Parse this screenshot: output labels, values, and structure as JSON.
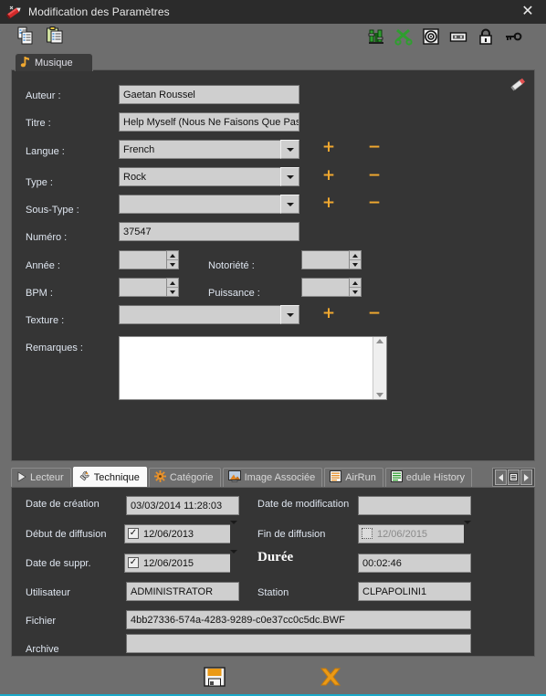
{
  "window": {
    "title": "Modification des Paramètres",
    "close_label": "✕",
    "title_icon": "marker-pen-icon",
    "accent_color": "#f0a830",
    "panel_bg": "#353535",
    "chrome_bg": "#6e6e6e",
    "titlebar_bg": "#2b2b2b",
    "bottom_accent": "#1ba9c9"
  },
  "toolbar": {
    "left_icons": [
      {
        "name": "copy-icon",
        "label": "Copier"
      },
      {
        "name": "paste-icon",
        "label": "Coller"
      }
    ],
    "right_icons": [
      {
        "name": "mixer-icon",
        "label": "Mixage"
      },
      {
        "name": "scissors-icon",
        "label": "Couper"
      },
      {
        "name": "target-icon",
        "label": "Cible"
      },
      {
        "name": "cassette-icon",
        "label": "Cassette"
      },
      {
        "name": "lock-icon",
        "label": "Verrouiller"
      },
      {
        "name": "key-icon",
        "label": "Clé"
      }
    ]
  },
  "main_tab": {
    "label": "Musique",
    "icon": "music-note-icon"
  },
  "pencil_icon": "pencil-icon",
  "form": {
    "fields": [
      {
        "id": "auteur",
        "label": "Auteur :",
        "value": "Gaetan Roussel",
        "type": "text"
      },
      {
        "id": "titre",
        "label": "Titre :",
        "value": "Help Myself (Nous Ne Faisons Que Pas",
        "type": "text"
      },
      {
        "id": "langue",
        "label": "Langue :",
        "value": "French",
        "type": "combo"
      },
      {
        "id": "type",
        "label": "Type :",
        "value": "Rock",
        "type": "combo"
      },
      {
        "id": "sous-type",
        "label": "Sous-Type :",
        "value": "",
        "type": "combo"
      },
      {
        "id": "numero",
        "label": "Numéro :",
        "value": "37547",
        "type": "text"
      }
    ],
    "spinners": [
      {
        "id": "annee",
        "label": "Année :",
        "value": ""
      },
      {
        "id": "notoriete",
        "label": "Notoriété :",
        "value": ""
      },
      {
        "id": "bpm",
        "label": "BPM :",
        "value": ""
      },
      {
        "id": "puissance",
        "label": "Puissance :",
        "value": ""
      }
    ],
    "texture": {
      "label": "Texture :",
      "value": ""
    },
    "remarques": {
      "label": "Remarques :",
      "value": ""
    },
    "add_label": "+",
    "remove_label": "−"
  },
  "tabs": [
    {
      "label": "Lecteur",
      "icon": "play-triangle-icon",
      "active": false
    },
    {
      "label": "Technique",
      "icon": "wrench-icon",
      "active": true
    },
    {
      "label": "Catégorie",
      "icon": "gear-orange-icon",
      "active": false
    },
    {
      "label": "Image Associée",
      "icon": "picture-icon",
      "active": false
    },
    {
      "label": "AirRun",
      "icon": "list-orange-icon",
      "active": false
    },
    {
      "label": "edule History",
      "icon": "list-green-icon",
      "active": false
    }
  ],
  "tab_nav": {
    "prev": "tab-scroll-left",
    "list": "tab-list",
    "next": "tab-scroll-right"
  },
  "technique": {
    "date_creation": {
      "label": "Date de création",
      "value": "03/03/2014 11:28:03"
    },
    "date_modification": {
      "label": "Date de modification",
      "value": ""
    },
    "debut_diffusion": {
      "label": "Début de diffusion",
      "value": "12/06/2013",
      "checked": true,
      "check_glyph": "✓"
    },
    "fin_diffusion": {
      "label": "Fin de diffusion",
      "value": "12/06/2015",
      "checked": false,
      "check_glyph": ""
    },
    "date_suppr": {
      "label": "Date de suppr.",
      "value": "12/06/2015",
      "checked": true,
      "check_glyph": "✓"
    },
    "duree": {
      "label": "Durée",
      "value": "00:02:46"
    },
    "utilisateur": {
      "label": "Utilisateur",
      "value": "ADMINISTRATOR"
    },
    "station": {
      "label": "Station",
      "value": "CLPAPOLINI1"
    },
    "fichier": {
      "label": "Fichier",
      "value": "4bb27336-574a-4283-9289-c0e37cc0c5dc.BWF"
    },
    "archive": {
      "label": "Archive",
      "value": ""
    }
  },
  "footer": {
    "save": {
      "name": "save-button",
      "icon": "floppy-disk-icon",
      "label": "Enregistrer"
    },
    "cancel": {
      "name": "cancel-button",
      "icon": "cross-orange-icon",
      "label": "Annuler"
    }
  }
}
